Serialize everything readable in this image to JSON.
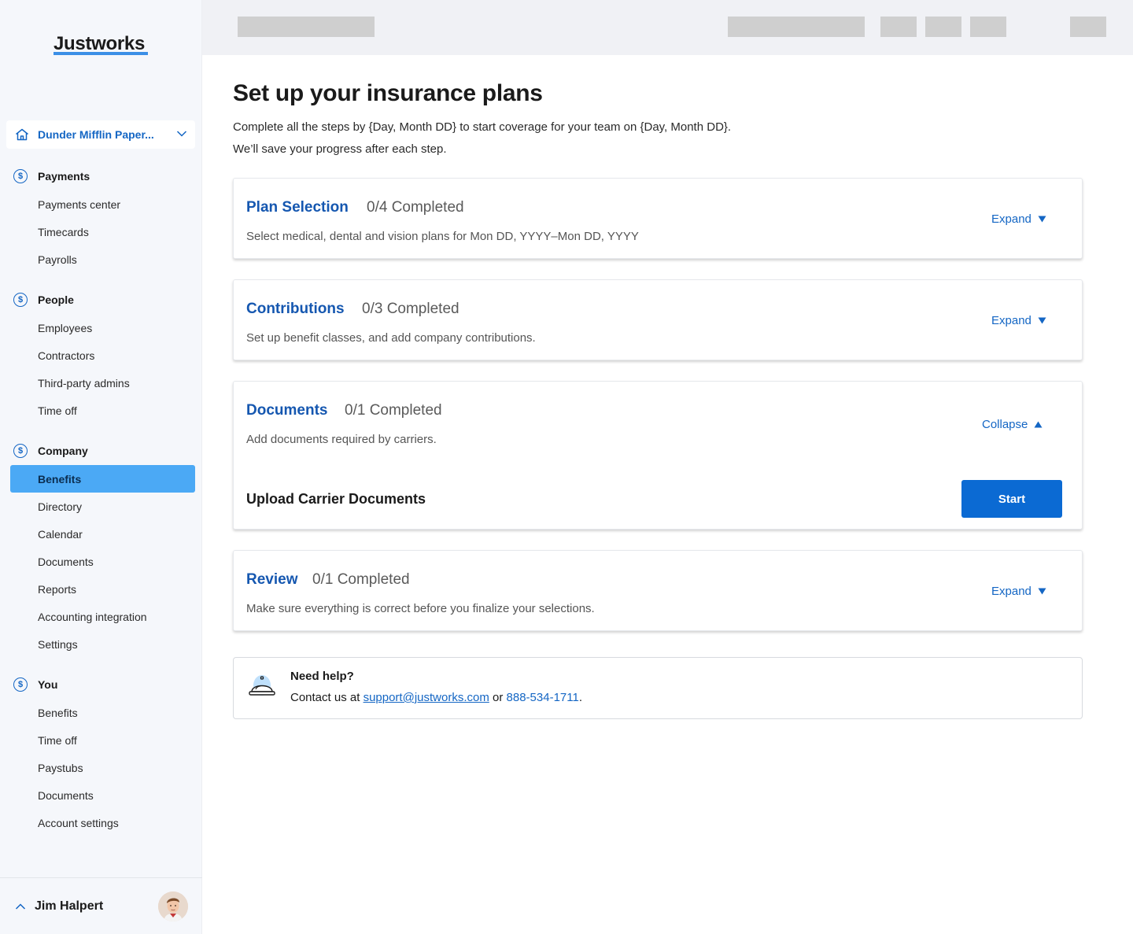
{
  "sidebar": {
    "logo": "Justworks",
    "company": {
      "name": "Dunder Mifflin Paper..."
    },
    "sections": [
      {
        "label": "Payments",
        "items": [
          "Payments center",
          "Timecards",
          "Payrolls"
        ]
      },
      {
        "label": "People",
        "items": [
          "Employees",
          "Contractors",
          "Third-party admins",
          "Time off"
        ]
      },
      {
        "label": "Company",
        "items": [
          "Benefits",
          "Directory",
          "Calendar",
          "Documents",
          "Reports",
          "Accounting integration",
          "Settings"
        ]
      },
      {
        "label": "You",
        "items": [
          "Benefits",
          "Time off",
          "Paystubs",
          "Documents",
          "Account settings"
        ]
      }
    ],
    "active_item": "Benefits",
    "user": {
      "name": "Jim Halpert"
    }
  },
  "page": {
    "title": "Set up your insurance plans",
    "subtitle_line1": "Complete all the steps by {Day, Month DD} to start coverage for your team on {Day, Month DD}.",
    "subtitle_line2": "We’ll save your progress after each step."
  },
  "steps": [
    {
      "title": "Plan Selection",
      "count": "0/4 Completed",
      "description": "Select medical, dental and vision plans for Mon DD, YYYY–Mon DD, YYYY",
      "toggle_label": "Expand",
      "expanded": false
    },
    {
      "title": "Contributions",
      "count": "0/3 Completed",
      "description": "Set up benefit classes, and add company contributions.",
      "toggle_label": "Expand",
      "expanded": false
    },
    {
      "title": "Documents",
      "count": "0/1 Completed",
      "description": "Add documents required by carriers.",
      "toggle_label": "Collapse",
      "expanded": true,
      "subtask": {
        "title": "Upload Carrier Documents",
        "button_label": "Start"
      }
    },
    {
      "title": "Review",
      "count": "0/1 Completed",
      "description": "Make sure everything is correct before you finalize your selections.",
      "toggle_label": "Expand",
      "expanded": false
    }
  ],
  "help": {
    "title": "Need help?",
    "prefix": "Contact us at",
    "email": "support@justworks.com",
    "middle": "or",
    "phone": "888-534-1711",
    "suffix": "."
  },
  "colors": {
    "brand_blue": "#1466c4",
    "title_blue": "#1557b0",
    "active_nav": "#4ba9f5",
    "button_blue": "#0b6ad3"
  }
}
